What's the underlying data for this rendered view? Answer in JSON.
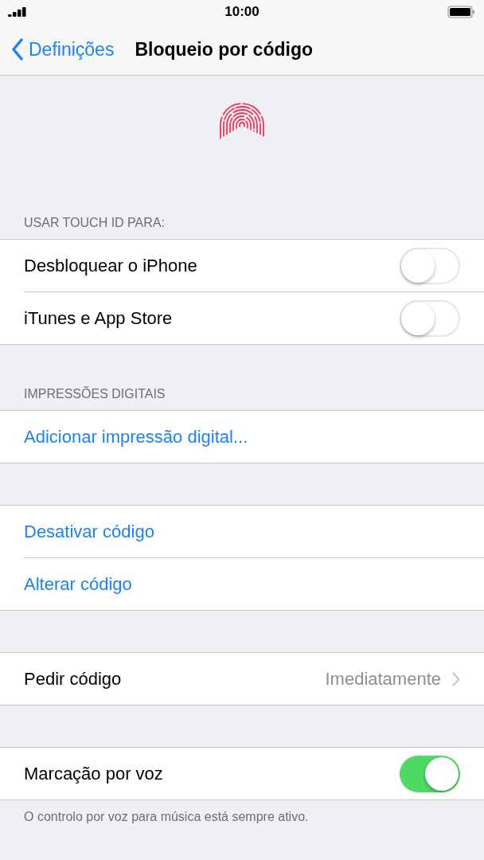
{
  "status_bar": {
    "time": "10:00"
  },
  "nav": {
    "back": "Definições",
    "title": "Bloqueio por código"
  },
  "sections": [
    {
      "header": "USAR TOUCH ID PARA:",
      "rows": [
        {
          "kind": "toggle",
          "label": "Desbloquear o iPhone",
          "on": false
        },
        {
          "kind": "toggle",
          "label": "iTunes e App Store",
          "on": false
        }
      ]
    },
    {
      "header": "IMPRESSÕES DIGITAIS",
      "rows": [
        {
          "kind": "link",
          "label": "Adicionar impressão digital..."
        }
      ]
    },
    {
      "rows": [
        {
          "kind": "link",
          "label": "Desativar código"
        },
        {
          "kind": "link",
          "label": "Alterar código"
        }
      ]
    },
    {
      "rows": [
        {
          "kind": "value",
          "label": "Pedir código",
          "value": "Imediatamente"
        }
      ]
    },
    {
      "rows": [
        {
          "kind": "toggle",
          "label": "Marcação por voz",
          "on": true
        }
      ],
      "footer": "O controlo por voz para música está sempre ativo."
    }
  ]
}
